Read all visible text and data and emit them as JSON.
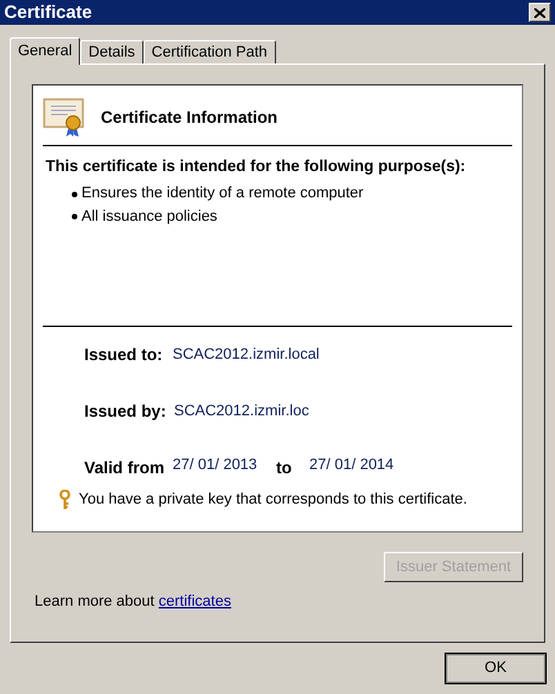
{
  "window": {
    "title": "Certificate"
  },
  "tabs": [
    {
      "label": "General",
      "selected": true
    },
    {
      "label": "Details",
      "selected": false
    },
    {
      "label": "Certification Path",
      "selected": false
    }
  ],
  "info": {
    "heading": "Certificate Information",
    "purpose_heading": "This certificate is intended for the following purpose(s):",
    "purposes": [
      "Ensures the identity of a remote computer",
      "All issuance policies"
    ],
    "issued_to": {
      "label": "Issued to:",
      "value": "SCAC2012.izmir.local"
    },
    "issued_by": {
      "label": "Issued by:",
      "value": "SCAC2012.izmir.loc"
    },
    "validity": {
      "from_label": "Valid from",
      "from": "27/ 01/ 2013",
      "to_label": "to",
      "to": "27/ 01/ 2014"
    },
    "key_note": "You have a private key that corresponds to this certificate."
  },
  "issuer_statement": {
    "label": "Issuer Statement",
    "disabled": true
  },
  "learn_more": {
    "text": "Learn more about",
    "link": "certificates"
  },
  "ok_button": {
    "label": "OK"
  }
}
